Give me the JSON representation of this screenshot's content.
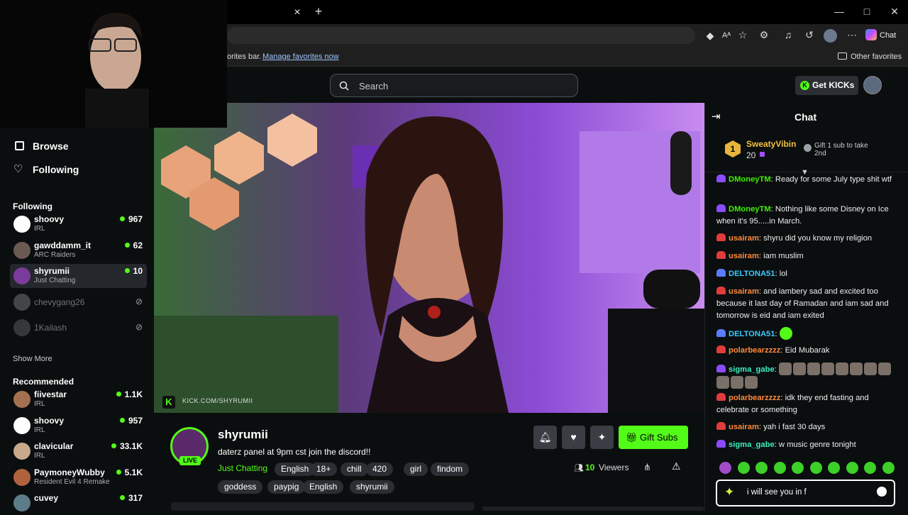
{
  "browser": {
    "favbar_text": "orites bar.",
    "favbar_link": "Manage favorites now",
    "other_favorites": "Other favorites",
    "chat_button": "Chat",
    "tab_close": "✕",
    "new_tab": "+"
  },
  "topnav": {
    "search_placeholder": "Search",
    "get_kicks": "Get KICKs"
  },
  "sidebar": {
    "browse": "Browse",
    "following_link": "Following",
    "following_header": "Following",
    "show_more": "Show More",
    "recommended_header": "Recommended",
    "following": [
      {
        "name": "shoovy",
        "category": "IRL",
        "viewers": "967",
        "color": "#ffffff"
      },
      {
        "name": "gawddamm_it",
        "category": "ARC Raiders",
        "viewers": "62",
        "color": "#6b5a52"
      },
      {
        "name": "shyrumii",
        "category": "Just Chatting",
        "viewers": "10",
        "color": "#7b3b9a"
      },
      {
        "name": "chevygang26",
        "category": "",
        "viewers": "",
        "color": "#8a8a8a"
      },
      {
        "name": "1Kailash",
        "category": "",
        "viewers": "",
        "color": "#6a6a6a"
      }
    ],
    "recommended": [
      {
        "name": "fiivestar",
        "category": "IRL",
        "viewers": "1.1K",
        "color": "#a5704f"
      },
      {
        "name": "shoovy",
        "category": "IRL",
        "viewers": "957",
        "color": "#ffffff"
      },
      {
        "name": "clavicular",
        "category": "IRL",
        "viewers": "33.1K",
        "color": "#c9a98c"
      },
      {
        "name": "PaymoneyWubby",
        "category": "Resident Evil 4 Remake",
        "viewers": "5.1K",
        "color": "#b0623f"
      },
      {
        "name": "cuvey",
        "category": "",
        "viewers": "317",
        "color": "#5d7c8a"
      }
    ]
  },
  "video": {
    "watermark": "KICK.COM/SHYRUMII"
  },
  "stream": {
    "channel": "shyrumii",
    "title": "daterz panel at 9pm cst join the discord!!",
    "live": "LIVE",
    "category": "Just Chatting",
    "tags_row1": [
      "English",
      "18+",
      "chill",
      "420",
      "girl",
      "findom"
    ],
    "tags_row2": [
      "goddess",
      "paypig",
      "English",
      "shyrumii"
    ],
    "viewers": "10",
    "viewers_label": "Viewers",
    "gift_subs": "Gift Subs"
  },
  "chat": {
    "title": "Chat",
    "leader_rank": "1",
    "leader_name": "SweatyVibin",
    "leader_count": "20",
    "gift_prompt": "Gift 1 sub to take 2nd",
    "messages": [
      {
        "user": "DMoneyTM",
        "text": "Ready for some July type shit wtf",
        "color": "#3cf000",
        "badge": "#8a4cff"
      },
      {
        "user": "DMoneyTM",
        "text": "Nothing like some Disney on Ice when it's 95.....in March.",
        "color": "#3cf000",
        "badge": "#8a4cff"
      },
      {
        "user": "usairam",
        "text": "shyru did you know my religion",
        "color": "#ff8a3c",
        "badge": "#e03c3c"
      },
      {
        "user": "usairam",
        "text": "iam muslim",
        "color": "#ff8a3c",
        "badge": "#e03c3c"
      },
      {
        "user": "DELTONA51",
        "text": "lol",
        "color": "#3cc8ff",
        "badge": "#5a7cff"
      },
      {
        "user": "usairam",
        "text": "and iambery sad and excited too because it last day of Ramadan and iam sad and tomorrow is eid and iam exited",
        "color": "#ff8a3c",
        "badge": "#e03c3c"
      },
      {
        "user": "DELTONA51",
        "text": "",
        "color": "#3cc8ff",
        "badge": "#5a7cff"
      },
      {
        "user": "polarbearzzzz",
        "text": "Eid Mubarak",
        "color": "#ff8a3c",
        "badge": "#e03c3c"
      },
      {
        "user": "sigma_gabe",
        "text": "",
        "color": "#3cf0c0",
        "badge": "#8a4cff"
      },
      {
        "user": "polarbearzzzz",
        "text": "idk they end fasting and celebrate or something",
        "color": "#ff8a3c",
        "badge": "#e03c3c"
      },
      {
        "user": "usairam",
        "text": "yah i fast 30 days",
        "color": "#ff8a3c",
        "badge": "#e03c3c"
      },
      {
        "user": "sigma_gabe",
        "text": "w music genre tonight",
        "color": "#3cf0c0",
        "badge": "#8a4cff"
      }
    ],
    "input_value": "i will see you in f"
  }
}
